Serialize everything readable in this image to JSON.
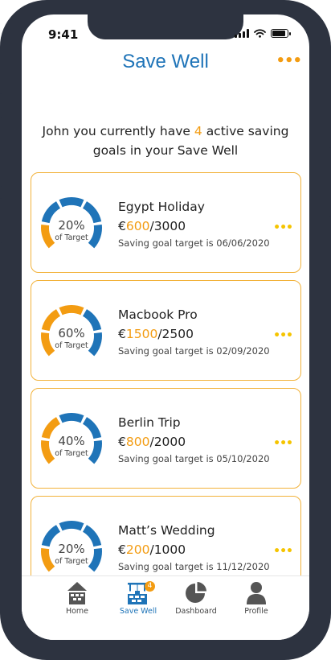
{
  "status_bar": {
    "time": "9:41"
  },
  "header": {
    "title": "Save Well",
    "menu_icon": "more-dots-icon"
  },
  "intro": {
    "before": "John you currently have",
    "count": "4",
    "after": "active saving goals in your Save Well"
  },
  "colors": {
    "blue": "#1f74b8",
    "orange": "#f39c12",
    "card_border": "#f2b23a"
  },
  "goals": [
    {
      "name": "Egypt Holiday",
      "currency": "€",
      "saved": "600",
      "total": "/3000",
      "percent_label": "20%",
      "percent_value": 0.2,
      "gauge_sub": "of Target",
      "target_text": "Saving goal target is 06/06/2020"
    },
    {
      "name": "Macbook Pro",
      "currency": "€",
      "saved": "1500",
      "total": "/2500",
      "percent_label": "60%",
      "percent_value": 0.6,
      "gauge_sub": "of Target",
      "target_text": "Saving goal target is 02/09/2020"
    },
    {
      "name": "Berlin Trip",
      "currency": "€",
      "saved": "800",
      "total": "/2000",
      "percent_label": "40%",
      "percent_value": 0.4,
      "gauge_sub": "of Target",
      "target_text": "Saving goal target is 05/10/2020"
    },
    {
      "name": "Matt’s Wedding",
      "currency": "€",
      "saved": "200",
      "total": "/1000",
      "percent_label": "20%",
      "percent_value": 0.2,
      "gauge_sub": "of Target",
      "target_text": "Saving goal target is 11/12/2020"
    }
  ],
  "tabs": [
    {
      "label": "Home",
      "icon": "home-icon",
      "active": false
    },
    {
      "label": "Save Well",
      "icon": "save-well-icon",
      "active": true,
      "badge": "4"
    },
    {
      "label": "Dashboard",
      "icon": "pie-chart-icon",
      "active": false
    },
    {
      "label": "Profile",
      "icon": "profile-icon",
      "active": false
    }
  ]
}
